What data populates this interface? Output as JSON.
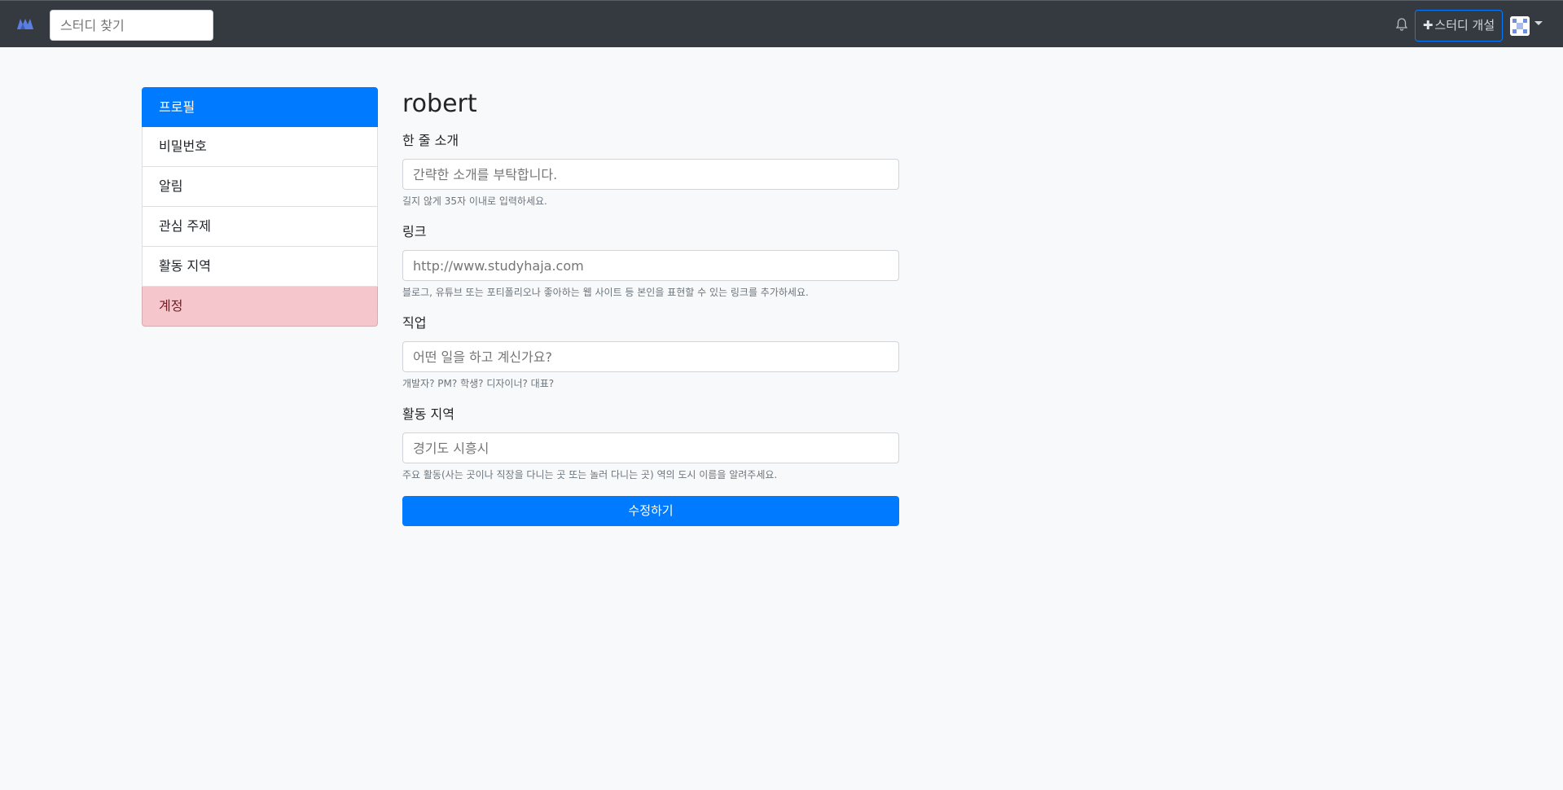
{
  "nav": {
    "search_placeholder": "스터디 찾기",
    "new_study_label": "스터디 개설",
    "icons": {
      "logo": "logo-icon",
      "bell": "bell-icon",
      "plus": "plus-icon",
      "avatar": "avatar-icon",
      "caret": "caret-down-icon"
    }
  },
  "sidebar": {
    "items": [
      {
        "label": "프로필",
        "state": "active"
      },
      {
        "label": "비밀번호"
      },
      {
        "label": "알림"
      },
      {
        "label": "관심 주제"
      },
      {
        "label": "활동 지역"
      },
      {
        "label": "계정",
        "state": "danger"
      }
    ]
  },
  "main": {
    "title": "robert",
    "fields": [
      {
        "label": "한 줄 소개",
        "placeholder": "간략한 소개를 부탁합니다.",
        "value": "",
        "help": "길지 않게 35자 이내로 입력하세요."
      },
      {
        "label": "링크",
        "placeholder": "http://www.studyhaja.com",
        "value": "",
        "help": "블로그, 유튜브 또는 포티폴리오나 좋아하는 웹 사이트 등 본인을 표현할 수 있는 링크를 추가하세요."
      },
      {
        "label": "직업",
        "placeholder": "어떤 일을 하고 계신가요?",
        "value": "",
        "help": "개발자? PM? 학생? 디자이너? 대표?"
      },
      {
        "label": "활동 지역",
        "placeholder": "경기도 시흥시",
        "value": "",
        "help": "주요 활동(사는 곳이나 직장을 다니는 곳 또는 놀러 다니는 곳) 역의 도시 이름을 알려주세요."
      }
    ],
    "submit_label": "수정하기"
  },
  "colors": {
    "navbar": "#343a40",
    "primary": "#007bff",
    "danger_bg": "#f5c6cb",
    "danger_text": "#721c24",
    "page_bg": "#f8f9fa"
  }
}
